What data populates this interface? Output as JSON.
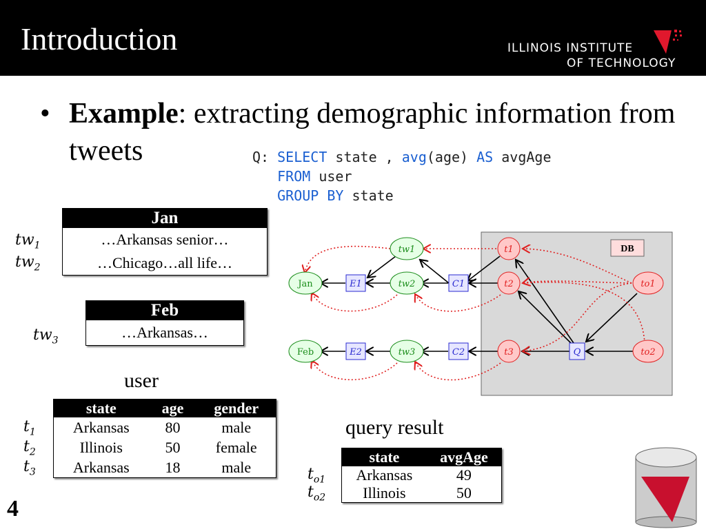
{
  "header": {
    "title": "Introduction",
    "logo_line1": "ILLINOIS INSTITUTE",
    "logo_line2": "OF TECHNOLOGY"
  },
  "bullet": {
    "bold": "Example",
    "rest": ": extracting demographic information from tweets"
  },
  "query": {
    "prefix": "Q: ",
    "select": "SELECT",
    "l1": " state , ",
    "avg": "avg",
    "l1b": "(age) ",
    "as": "AS",
    "l1c": " avgAge",
    "from": "FROM",
    "l2": " user",
    "group": "GROUP BY",
    "l3": " state"
  },
  "jan": {
    "header": "Jan",
    "rows": [
      {
        "label": "tw",
        "sub": "1",
        "text": "…Arkansas senior…"
      },
      {
        "label": "tw",
        "sub": "2",
        "text": "…Chicago…all life…"
      }
    ]
  },
  "feb": {
    "header": "Feb",
    "rows": [
      {
        "label": "tw",
        "sub": "3",
        "text": "…Arkansas…"
      }
    ]
  },
  "user": {
    "caption": "user",
    "columns": [
      "state",
      "age",
      "gender"
    ],
    "rows": [
      {
        "label": "t",
        "sub": "1",
        "cells": [
          "Arkansas",
          "80",
          "male"
        ]
      },
      {
        "label": "t",
        "sub": "2",
        "cells": [
          "Illinois",
          "50",
          "female"
        ]
      },
      {
        "label": "t",
        "sub": "3",
        "cells": [
          "Arkansas",
          "18",
          "male"
        ]
      }
    ]
  },
  "result": {
    "caption": "query result",
    "columns": [
      "state",
      "avgAge"
    ],
    "rows": [
      {
        "label": "t",
        "sub": "o1",
        "cells": [
          "Arkansas",
          "49"
        ]
      },
      {
        "label": "t",
        "sub": "o2",
        "cells": [
          "Illinois",
          "50"
        ]
      }
    ]
  },
  "diagram": {
    "db_label": "DB",
    "nodes": {
      "jan": "Jan",
      "feb": "Feb",
      "e1": "E1",
      "e2": "E2",
      "c1": "C1",
      "c2": "C2",
      "tw1": "tw1",
      "tw2": "tw2",
      "tw3": "tw3",
      "t1": "t1",
      "t2": "t2",
      "t3": "t3",
      "to1": "to1",
      "to2": "to2",
      "q": "Q"
    },
    "colors": {
      "green": "#1a8c1a",
      "blue": "#2a2ad0",
      "red": "#e02020",
      "db_bg": "#d9d9d9"
    }
  },
  "page_number": "4"
}
